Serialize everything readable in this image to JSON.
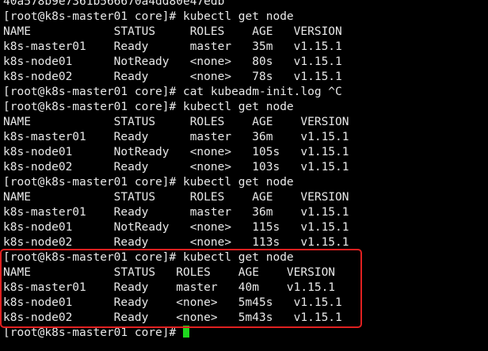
{
  "terminal": {
    "partial_top_line": "40a578b9e7361b566670a4dd80e47edb",
    "prompt": "[root@k8s-master01 core]# ",
    "lines": [
      "[root@k8s-master01 core]# kubectl get node",
      "NAME            STATUS     ROLES    AGE   VERSION",
      "k8s-master01    Ready      master   35m   v1.15.1",
      "k8s-node01      NotReady   <none>   80s   v1.15.1",
      "k8s-node02      Ready      <none>   78s   v1.15.1",
      "[root@k8s-master01 core]# cat kubeadm-init.log ^C",
      "[root@k8s-master01 core]# kubectl get node",
      "NAME            STATUS     ROLES    AGE    VERSION",
      "k8s-master01    Ready      master   36m    v1.15.1",
      "k8s-node01      NotReady   <none>   105s   v1.15.1",
      "k8s-node02      Ready      <none>   103s   v1.15.1",
      "[root@k8s-master01 core]# kubectl get node",
      "NAME            STATUS     ROLES    AGE    VERSION",
      "k8s-master01    Ready      master   36m    v1.15.1",
      "k8s-node01      NotReady   <none>   115s   v1.15.1",
      "k8s-node02      Ready      <none>   113s   v1.15.1",
      "[root@k8s-master01 core]# kubectl get node",
      "NAME            STATUS   ROLES    AGE    VERSION",
      "k8s-master01    Ready    master   40m    v1.15.1",
      "k8s-node01      Ready    <none>   5m45s   v1.15.1",
      "k8s-node02      Ready    <none>   5m43s   v1.15.1"
    ]
  },
  "colors": {
    "background": "#000000",
    "text": "#e8e8e8",
    "cursor": "#1ed81e",
    "highlight_border": "#e02020"
  }
}
